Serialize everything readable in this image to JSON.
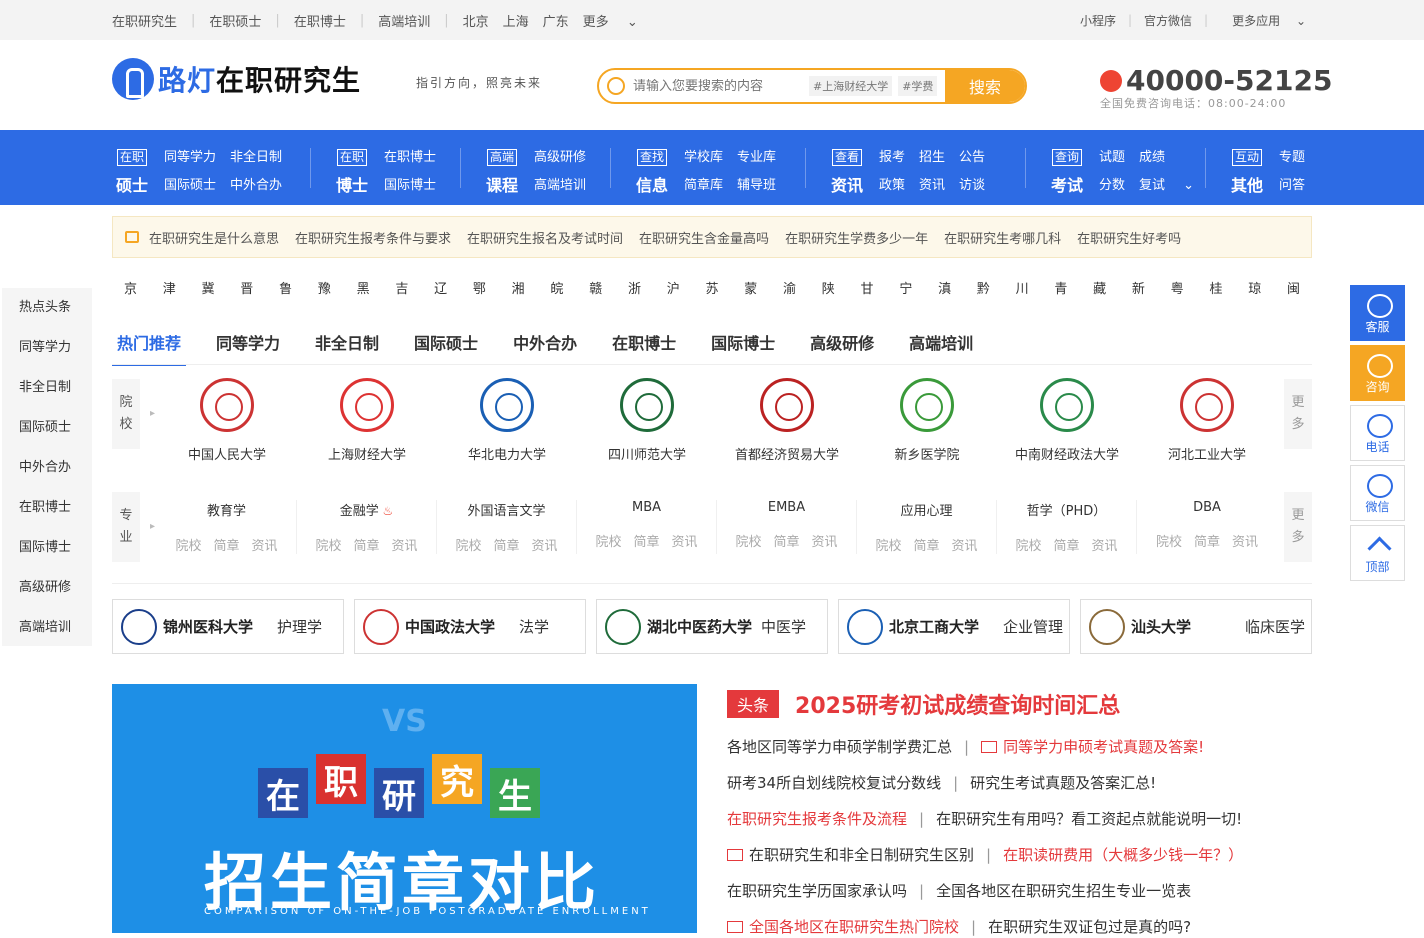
{
  "topbar": {
    "left_links": [
      "在职研究生",
      "在职硕士",
      "在职博士",
      "高端培训"
    ],
    "cities": [
      "北京",
      "上海",
      "广东"
    ],
    "more": "更多",
    "right_links": [
      "小程序",
      "官方微信",
      "更多应用"
    ]
  },
  "header": {
    "logo_blue": "路灯",
    "logo_black": "在职研究生",
    "slogan": "指引方向，照亮未来",
    "search": {
      "placeholder": "请输入您要搜索的内容",
      "tags": [
        "#上海财经大学",
        "#学费"
      ],
      "button": "搜索"
    },
    "phone": {
      "number": "40000-52125",
      "sub": "全国免费咨询电话：08:00-24:00"
    }
  },
  "nav": [
    {
      "tag": "在职",
      "title": "硕士",
      "row1": [
        "同等学力",
        "非全日制"
      ],
      "row2": [
        "国际硕士",
        "中外合办"
      ]
    },
    {
      "tag": "在职",
      "title": "博士",
      "row1": [
        "在职博士"
      ],
      "row2": [
        "国际博士"
      ]
    },
    {
      "tag": "高端",
      "title": "课程",
      "row1": [
        "高级研修"
      ],
      "row2": [
        "高端培训"
      ]
    },
    {
      "tag": "查找",
      "title": "信息",
      "row1": [
        "学校库",
        "专业库"
      ],
      "row2": [
        "简章库",
        "辅导班"
      ]
    },
    {
      "tag": "查看",
      "title": "资讯",
      "row1": [
        "报考",
        "招生",
        "公告"
      ],
      "row2": [
        "政策",
        "资讯",
        "访谈"
      ]
    },
    {
      "tag": "查询",
      "title": "考试",
      "row1": [
        "试题",
        "成绩"
      ],
      "row2": [
        "分数",
        "复试"
      ]
    },
    {
      "tag": "互动",
      "title": "其他",
      "row1": [
        "专题"
      ],
      "row2": [
        "问答"
      ]
    }
  ],
  "notice": [
    "在职研究生是什么意思",
    "在职研究生报考条件与要求",
    "在职研究生报名及考试时间",
    "在职研究生含金量高吗",
    "在职研究生学费多少一年",
    "在职研究生考哪几科",
    "在职研究生好考吗"
  ],
  "provinces": [
    "京",
    "津",
    "冀",
    "晋",
    "鲁",
    "豫",
    "黑",
    "吉",
    "辽",
    "鄂",
    "湘",
    "皖",
    "赣",
    "浙",
    "沪",
    "苏",
    "蒙",
    "渝",
    "陕",
    "甘",
    "宁",
    "滇",
    "黔",
    "川",
    "青",
    "藏",
    "新",
    "粤",
    "桂",
    "琼",
    "闽"
  ],
  "sidebar": [
    "热点头条",
    "同等学力",
    "非全日制",
    "国际硕士",
    "中外合办",
    "在职博士",
    "国际博士",
    "高级研修",
    "高端培训"
  ],
  "tabs": [
    "热门推荐",
    "同等学力",
    "非全日制",
    "国际硕士",
    "中外合办",
    "在职博士",
    "国际博士",
    "高级研修",
    "高端培训"
  ],
  "schools_label": [
    "院",
    "校"
  ],
  "schools": [
    "中国人民大学",
    "上海财经大学",
    "华北电力大学",
    "四川师范大学",
    "首都经济贸易大学",
    "新乡医学院",
    "中南财经政法大学",
    "河北工业大学"
  ],
  "majors_label": [
    "专",
    "业"
  ],
  "majors": [
    "教育学",
    "金融学",
    "外国语言文学",
    "MBA",
    "EMBA",
    "应用心理",
    "哲学（PHD）",
    "DBA"
  ],
  "major_links": [
    "院校",
    "简章",
    "资讯"
  ],
  "more_label": [
    "更",
    "多"
  ],
  "ads": [
    {
      "uni": "锦州医科大学",
      "field": "护理学"
    },
    {
      "uni": "中国政法大学",
      "field": "法学"
    },
    {
      "uni": "湖北中医药大学",
      "field": "中医学"
    },
    {
      "uni": "北京工商大学",
      "field": "企业管理"
    },
    {
      "uni": "汕头大学",
      "field": "临床医学"
    }
  ],
  "banner": {
    "chars": [
      "在",
      "职",
      "研",
      "究",
      "生"
    ],
    "title": "招生简章对比",
    "en": "COMPARISON OF ON-THE-JOB POSTGRADUATE ENROLLMENT",
    "vs": "VS"
  },
  "news": {
    "badge": "头条",
    "headline": "2025研考初试成绩查询时间汇总",
    "l1a": "各地区同等学力申硕学制学费汇总",
    "l1b": "同等学力申硕考试真题及答案!",
    "l2a": "研考34所自划线院校复试分数线",
    "l2b": "研究生考试真题及答案汇总!",
    "l3a": "在职研究生报考条件及流程",
    "l3b": "在职研究生有用吗？看工资起点就能说明一切!",
    "l4a": "在职研究生和非全日制研究生区别",
    "l4b": "在职读研费用（大概多少钱一年？）",
    "l5a": "在职研究生学历国家承认吗",
    "l5b": "全国各地区在职研究生招生专业一览表",
    "l6a": "全国各地区在职研究生热门院校",
    "l6b": "在职研究生双证包过是真的吗?"
  },
  "float": [
    "客服",
    "咨询",
    "电话",
    "微信",
    "顶部"
  ],
  "colors": {
    "primary": "#2d6be4",
    "accent": "#f5a623",
    "red": "#e4393c"
  }
}
